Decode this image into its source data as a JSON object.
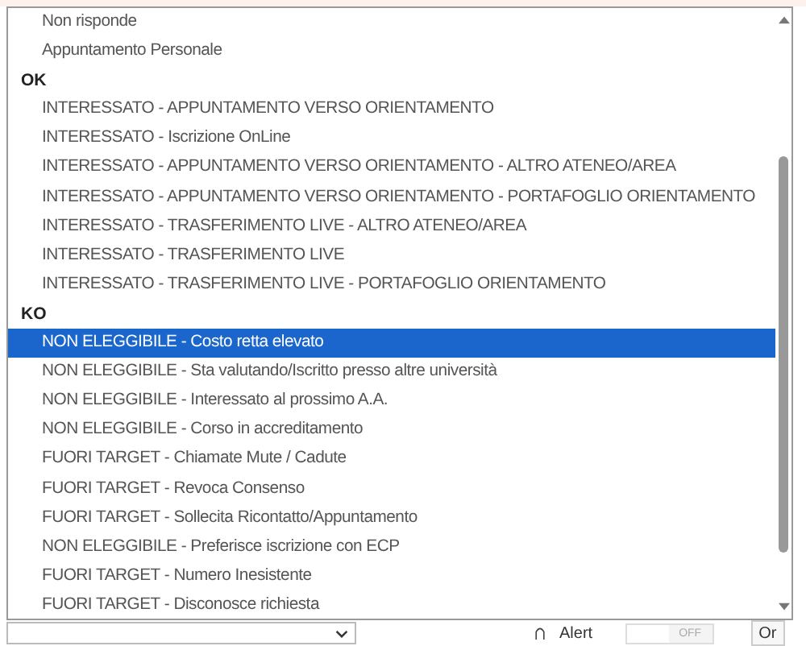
{
  "dropdown": {
    "items": [
      {
        "kind": "option",
        "label": "Non risponde",
        "selected": false
      },
      {
        "kind": "option",
        "label": "Appuntamento Personale",
        "selected": false
      },
      {
        "kind": "group",
        "label": "OK"
      },
      {
        "kind": "option",
        "label": "INTERESSATO - APPUNTAMENTO VERSO ORIENTAMENTO",
        "selected": false
      },
      {
        "kind": "option",
        "label": "INTERESSATO - Iscrizione OnLine",
        "selected": false
      },
      {
        "kind": "option",
        "label": "INTERESSATO - APPUNTAMENTO VERSO ORIENTAMENTO - ALTRO ATENEO/AREA",
        "selected": false
      },
      {
        "kind": "option",
        "label": "INTERESSATO - APPUNTAMENTO VERSO ORIENTAMENTO - PORTAFOGLIO ORIENTAMENTO",
        "selected": false
      },
      {
        "kind": "option",
        "label": "INTERESSATO - TRASFERIMENTO LIVE - ALTRO ATENEO/AREA",
        "selected": false
      },
      {
        "kind": "option",
        "label": "INTERESSATO - TRASFERIMENTO LIVE",
        "selected": false
      },
      {
        "kind": "option",
        "label": "INTERESSATO - TRASFERIMENTO LIVE - PORTAFOGLIO ORIENTAMENTO",
        "selected": false
      },
      {
        "kind": "group",
        "label": "KO"
      },
      {
        "kind": "option",
        "label": "NON ELEGGIBILE - Costo retta elevato",
        "selected": true
      },
      {
        "kind": "option",
        "label": "NON ELEGGIBILE - Sta valutando/Iscritto presso altre università",
        "selected": false
      },
      {
        "kind": "option",
        "label": "NON ELEGGIBILE - Interessato al prossimo A.A.",
        "selected": false
      },
      {
        "kind": "option",
        "label": "NON ELEGGIBILE - Corso in accreditamento",
        "selected": false
      },
      {
        "kind": "option",
        "label": "FUORI TARGET - Chiamate Mute / Cadute",
        "selected": false
      },
      {
        "kind": "option",
        "label": "FUORI TARGET - Revoca Consenso",
        "selected": false
      },
      {
        "kind": "option",
        "label": "FUORI TARGET - Sollecita Ricontatto/Appuntamento",
        "selected": false
      },
      {
        "kind": "option",
        "label": "NON ELEGGIBILE - Preferisce iscrizione con ECP",
        "selected": false
      },
      {
        "kind": "option",
        "label": "FUORI TARGET - Numero Inesistente",
        "selected": false
      },
      {
        "kind": "option",
        "label": "FUORI TARGET - Disconosce richiesta",
        "selected": false
      }
    ]
  },
  "bottom_bar": {
    "alert_label": "Alert",
    "toggle": {
      "label": "OFF",
      "on": false
    },
    "button": "Or"
  }
}
